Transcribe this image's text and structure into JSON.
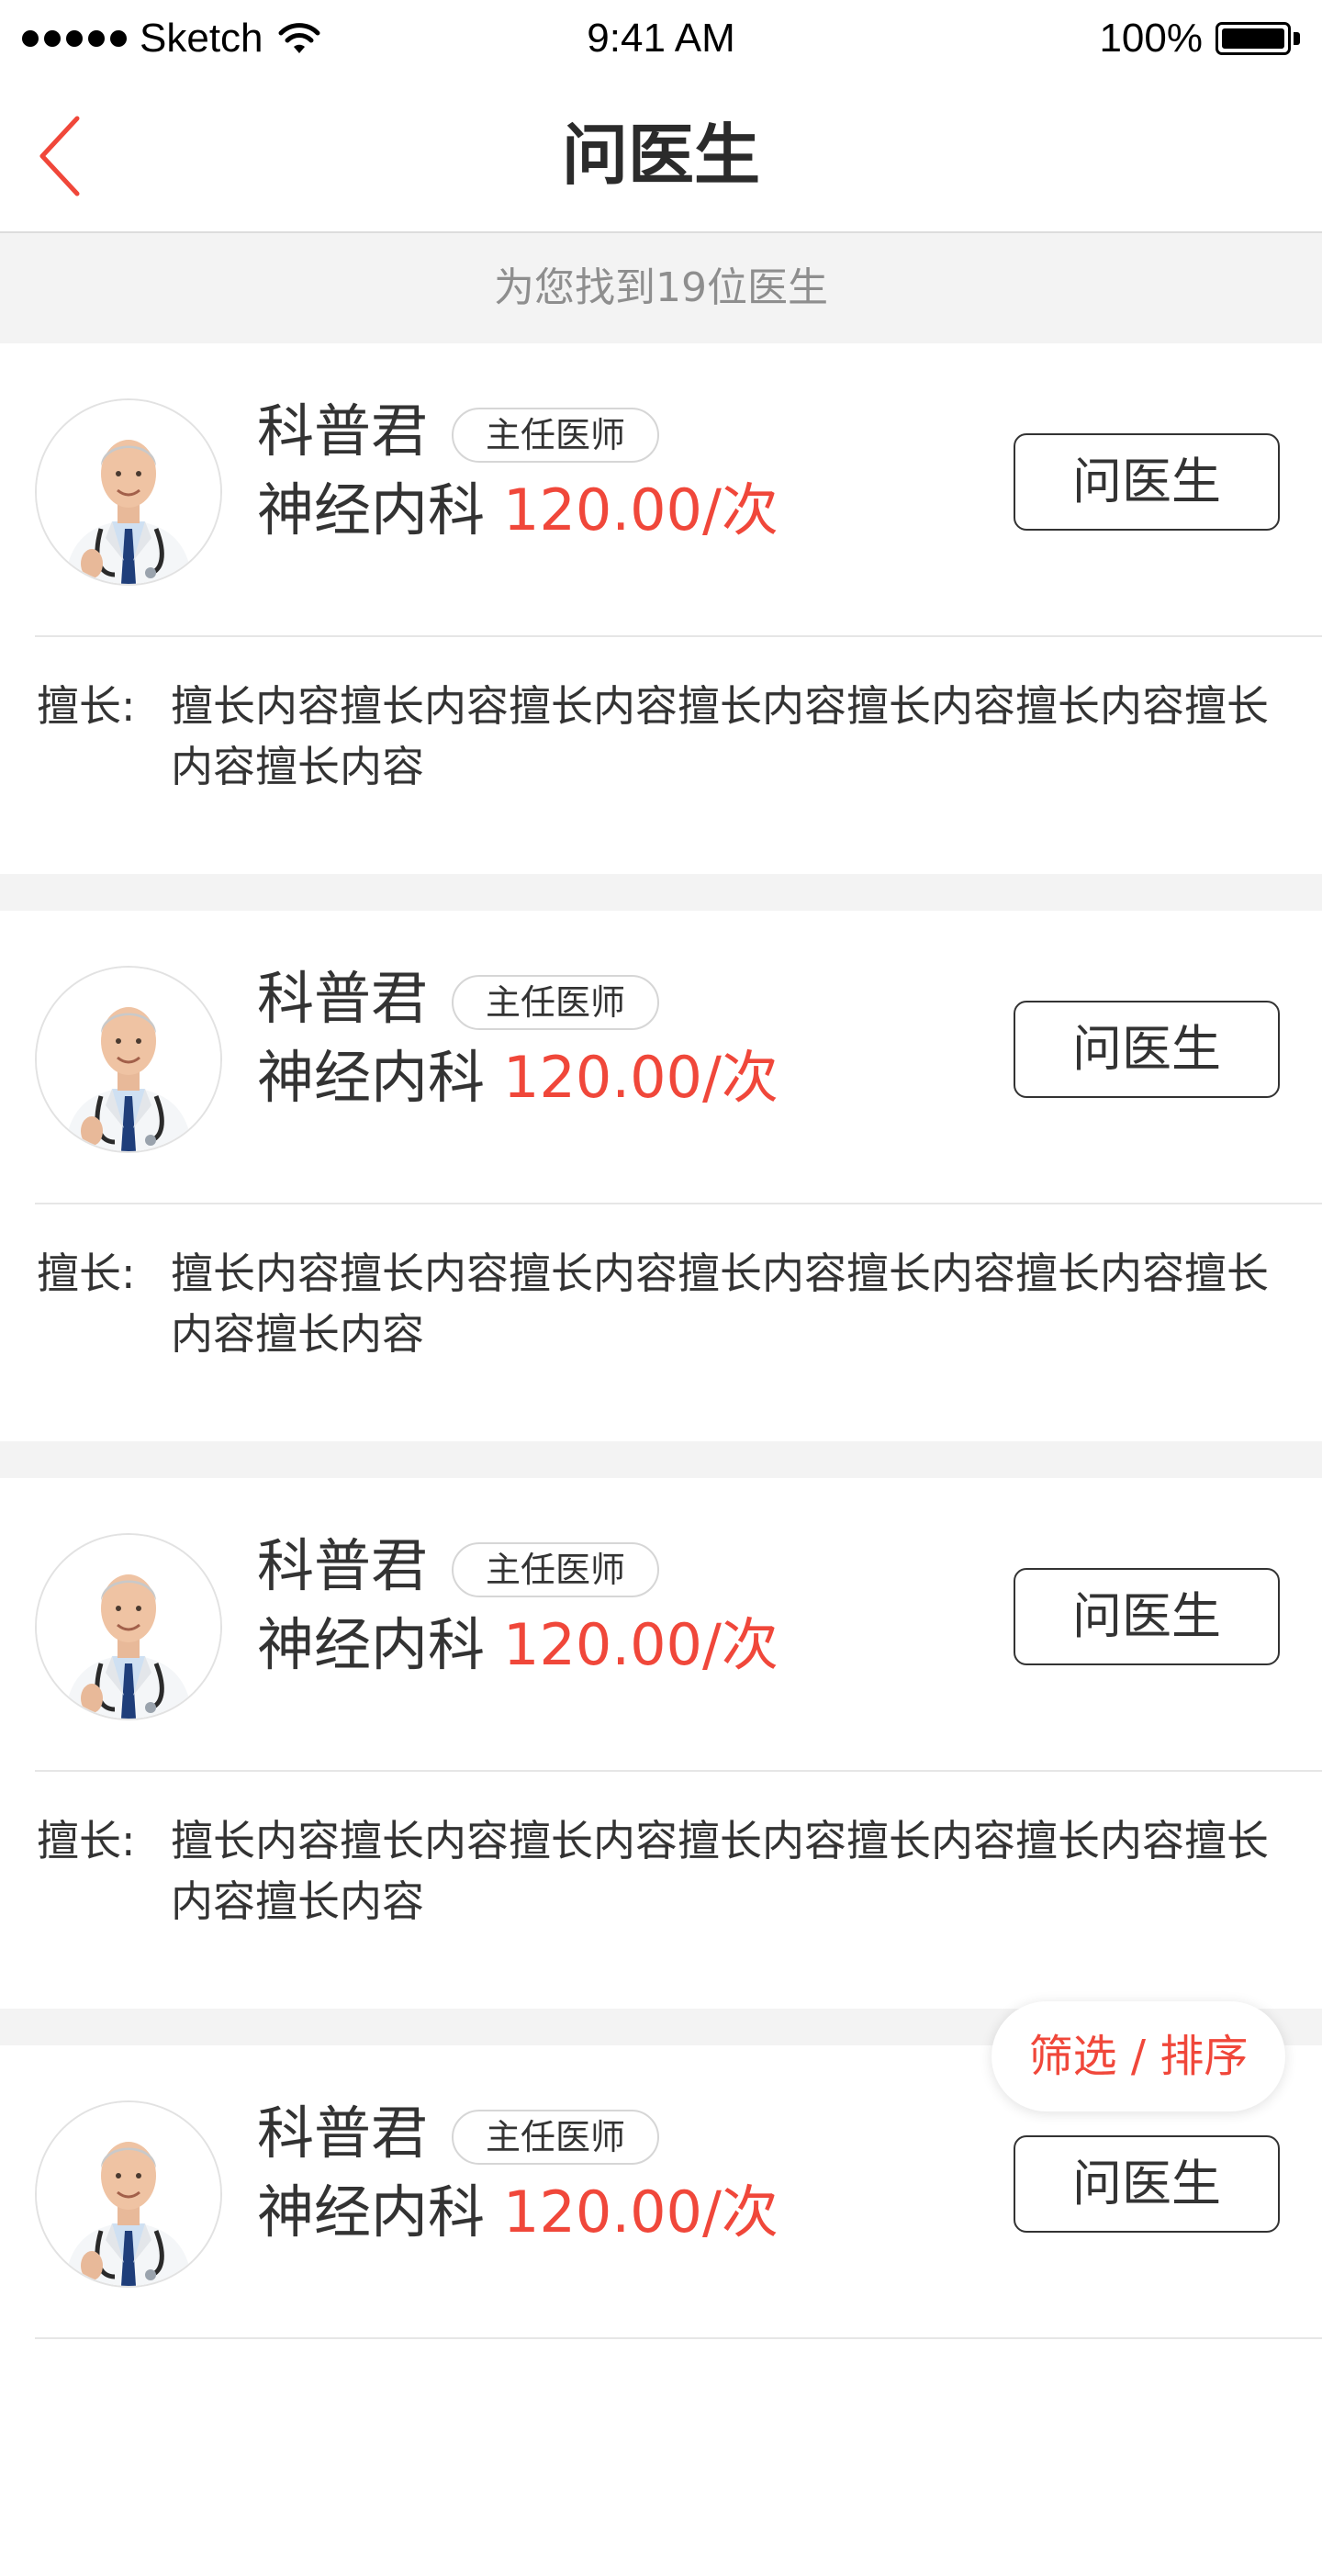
{
  "status_bar": {
    "carrier": "Sketch",
    "time": "9:41 AM",
    "battery": "100%"
  },
  "nav": {
    "title": "问医生",
    "back_icon": "chevron-left-icon",
    "accent_color": "#f0473a"
  },
  "result_summary": "为您找到19位医生",
  "doctors": [
    {
      "name": "科普君",
      "title": "主任医师",
      "department": "神经内科",
      "price": "120.00/次",
      "ask_label": "问医生",
      "expertise_label": "擅长:",
      "expertise": "擅长内容擅长内容擅长内容擅长内容擅长内容擅长内容擅长内容擅长内容"
    },
    {
      "name": "科普君",
      "title": "主任医师",
      "department": "神经内科",
      "price": "120.00/次",
      "ask_label": "问医生",
      "expertise_label": "擅长:",
      "expertise": "擅长内容擅长内容擅长内容擅长内容擅长内容擅长内容擅长内容擅长内容"
    },
    {
      "name": "科普君",
      "title": "主任医师",
      "department": "神经内科",
      "price": "120.00/次",
      "ask_label": "问医生",
      "expertise_label": "擅长:",
      "expertise": "擅长内容擅长内容擅长内容擅长内容擅长内容擅长内容擅长内容擅长内容"
    },
    {
      "name": "科普君",
      "title": "主任医师",
      "department": "神经内科",
      "price": "120.00/次",
      "ask_label": "问医生",
      "expertise_label": "",
      "expertise": ""
    }
  ],
  "filter_button": "筛选 / 排序"
}
